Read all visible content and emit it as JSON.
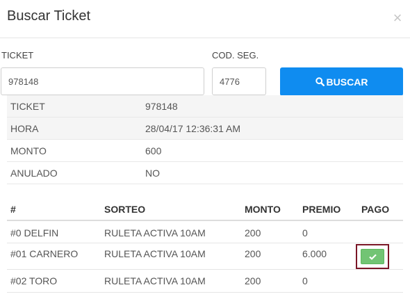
{
  "modal": {
    "title": "Buscar Ticket",
    "close_icon": "close-icon"
  },
  "form": {
    "ticket_label": "TICKET",
    "ticket_value": "978148",
    "code_label": "COD. SEG.",
    "code_value": "4776",
    "search_label": "BUSCAR",
    "search_icon": "search-icon",
    "search_color": "#0f8cf0"
  },
  "info": [
    {
      "key": "TICKET",
      "value": "978148"
    },
    {
      "key": "HORA",
      "value": "28/04/17 12:36:31 AM"
    },
    {
      "key": "MONTO",
      "value": "600"
    },
    {
      "key": "ANULADO",
      "value": "NO"
    }
  ],
  "bets": {
    "headers": [
      "#",
      "SORTEO",
      "MONTO",
      "PREMIO",
      "PAGO"
    ],
    "rows": [
      {
        "id": "#0 DELFIN",
        "sorteo": "RULETA ACTIVA 10AM",
        "monto": "200",
        "premio": "0",
        "pago": null
      },
      {
        "id": "#01 CARNERO",
        "sorteo": "RULETA ACTIVA 10AM",
        "monto": "200",
        "premio": "6.000",
        "pago": "check-icon"
      },
      {
        "id": "#02 TORO",
        "sorteo": "RULETA ACTIVA 10AM",
        "monto": "200",
        "premio": "0",
        "pago": null
      }
    ],
    "pay_button_color": "#72c474",
    "highlight_color": "#7a1626"
  }
}
